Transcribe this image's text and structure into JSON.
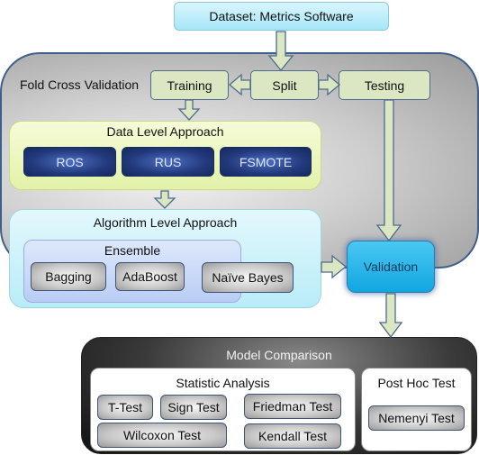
{
  "dataset": {
    "label": "Dataset: Metrics Software"
  },
  "fold_cross_validation": {
    "title": "Fold Cross Validation",
    "training": "Training",
    "split": "Split",
    "testing": "Testing",
    "validation": "Validation"
  },
  "data_level": {
    "title": "Data Level Approach",
    "methods": [
      "ROS",
      "RUS",
      "FSMOTE"
    ]
  },
  "algorithm_level": {
    "title": "Algorithm Level Approach",
    "ensemble": {
      "title": "Ensemble",
      "methods": [
        "Bagging",
        "AdaBoost"
      ]
    },
    "classifier": "Naïve Bayes"
  },
  "model_comparison": {
    "title": "Model Comparison",
    "statistic_analysis": {
      "title": "Statistic Analysis",
      "tests": [
        "T-Test",
        "Sign Test",
        "Friedman Test",
        "Wilcoxon Test",
        "Kendall Test"
      ]
    },
    "post_hoc": {
      "title": "Post Hoc Test",
      "tests": [
        "Nemenyi Test"
      ]
    }
  },
  "colors": {
    "arrow_fill": "#dbe7c3",
    "arrow_stroke": "#4f6a8f",
    "border_blue": "#3d5f8a",
    "validation_blue": "#1fb1e8",
    "navy_button": "#22397c"
  }
}
